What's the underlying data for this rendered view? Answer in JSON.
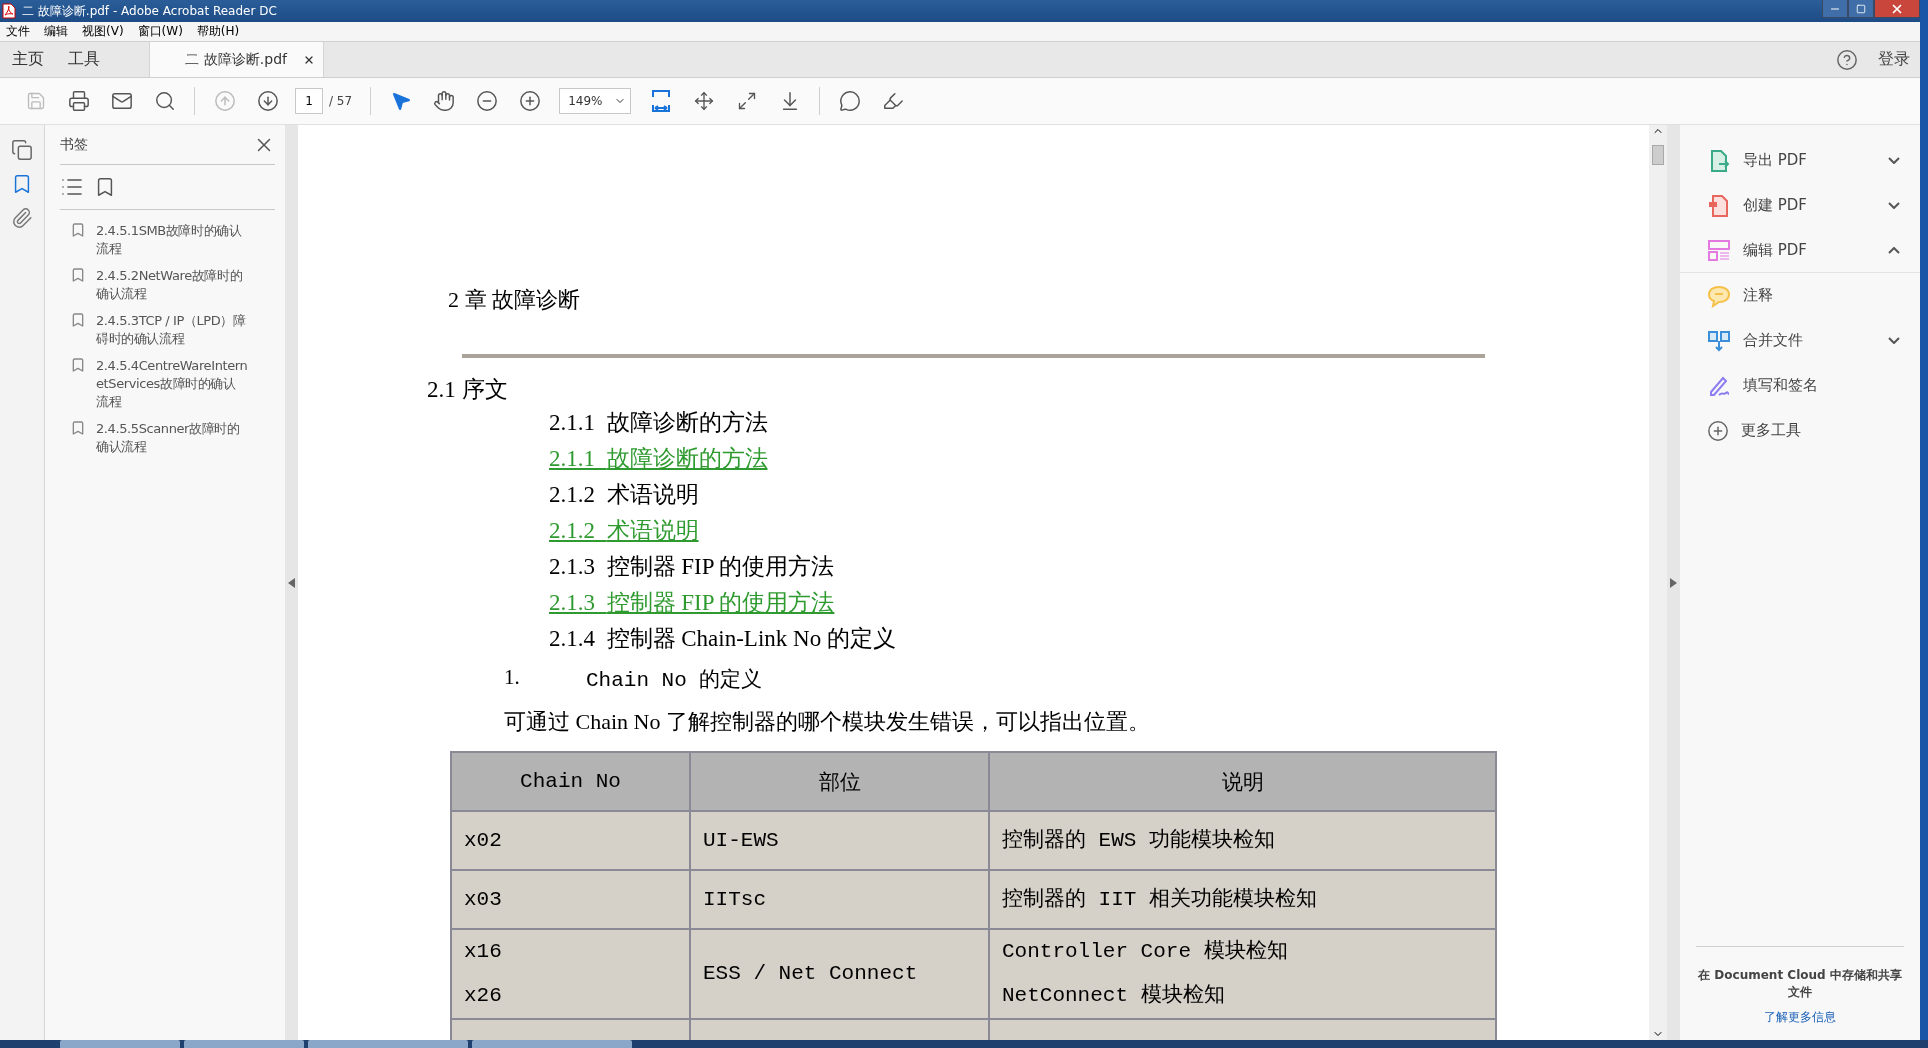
{
  "window": {
    "title": "二 故障诊断.pdf - Adobe Acrobat Reader DC"
  },
  "menu": [
    "文件",
    "编辑",
    "视图(V)",
    "窗口(W)",
    "帮助(H)"
  ],
  "tabs": [
    {
      "label": "主页",
      "kind": "nav",
      "selected": false
    },
    {
      "label": "工具",
      "kind": "nav",
      "selected": false
    },
    {
      "label": "二 故障诊断.pdf",
      "kind": "document",
      "selected": true
    }
  ],
  "account": {
    "login": "登录"
  },
  "toolbar": {
    "page": "1",
    "page_total": "/ 57",
    "zoom": "149%"
  },
  "bookmarks_panel": {
    "title": "书签",
    "items": [
      {
        "label": "2.4.5.1SMB故障时的确认流程"
      },
      {
        "label": "2.4.5.2NetWare故障时的确认流程"
      },
      {
        "label": "2.4.5.3TCP / IP（LPD）障碍时的确认流程"
      },
      {
        "label": "2.4.5.4CentreWareInternetServices故障时的确认流程"
      },
      {
        "label": "2.4.5.5Scanner故障时的确认流程"
      }
    ]
  },
  "document": {
    "chapter": "2 章  故障诊断",
    "section": "2.1  序文",
    "toc": [
      {
        "number": "2.1.1",
        "text": "故障诊断的方法",
        "kind": "heading"
      },
      {
        "number": "2.1.1",
        "text": "故障诊断的方法",
        "kind": "link"
      },
      {
        "number": "2.1.2",
        "text": "术语说明",
        "kind": "heading"
      },
      {
        "number": "2.1.2",
        "text": "术语说明",
        "kind": "link"
      },
      {
        "number": "2.1.3",
        "text": "控制器 FIP 的使用方法",
        "kind": "heading"
      },
      {
        "number": "2.1.3",
        "text": "控制器 FIP 的使用方法",
        "kind": "link"
      },
      {
        "number": "2.1.4",
        "text": "控制器 Chain-Link No 的定义",
        "kind": "heading"
      }
    ],
    "list_item": {
      "marker": "1.",
      "text": "Chain No 的定义"
    },
    "paragraph": "可通过 Chain No 了解控制器的哪个模块发生错误，可以指出位置。",
    "table": {
      "columns": [
        "Chain No",
        "部位",
        "说明"
      ],
      "rows": [
        {
          "cells": [
            [
              "x02"
            ],
            [
              "UI-EWS"
            ],
            [
              "控制器的 EWS 功能模块检知"
            ]
          ]
        },
        {
          "cells": [
            [
              "x03"
            ],
            [
              "IITsc"
            ],
            [
              "控制器的 IIT 相关功能模块检知"
            ]
          ]
        },
        {
          "cells": [
            [
              "x16",
              "x26"
            ],
            [
              "ESS / Net Connect"
            ],
            [
              "Controller Core 模块检知",
              "NetConnect 模块检知"
            ]
          ]
        }
      ]
    }
  },
  "tools_panel": {
    "items": [
      {
        "label": "导出 PDF",
        "kind": "group",
        "expanded": false
      },
      {
        "label": "创建 PDF",
        "kind": "group",
        "expanded": false
      },
      {
        "label": "编辑 PDF",
        "kind": "group",
        "expanded": true
      },
      {
        "label": "注释",
        "kind": "tool"
      },
      {
        "label": "合并文件",
        "kind": "group",
        "expanded": false
      },
      {
        "label": "填写和签名",
        "kind": "tool"
      },
      {
        "label": "更多工具",
        "kind": "tool"
      }
    ],
    "cloud_text": "在 Document Cloud 中存储和共享文件",
    "cloud_link": "了解更多信息"
  }
}
